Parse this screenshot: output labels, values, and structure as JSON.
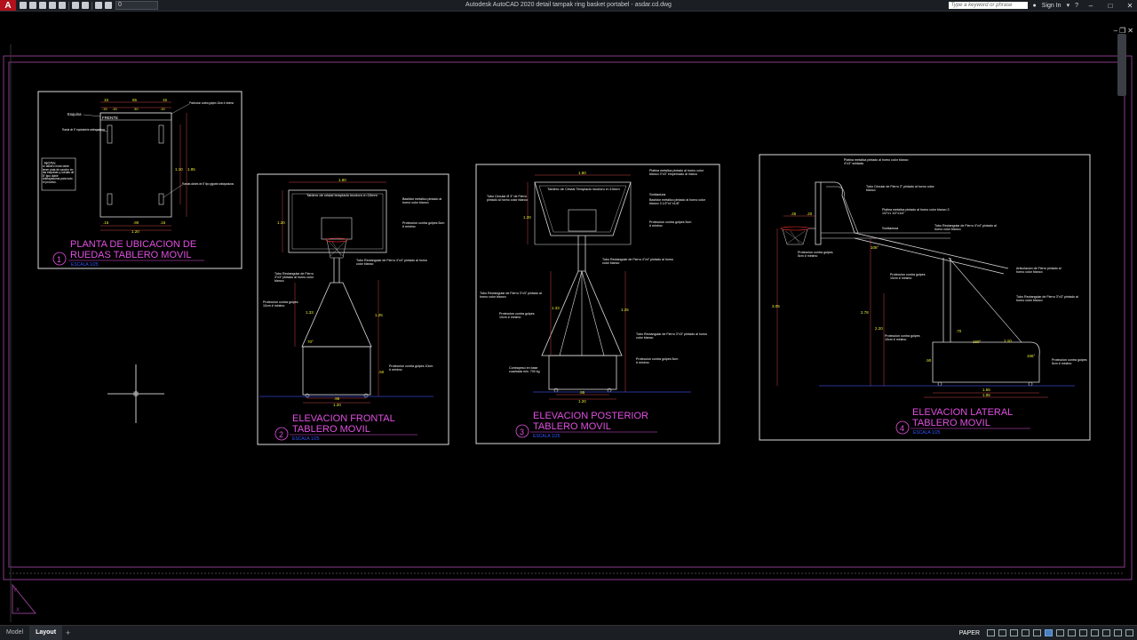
{
  "window": {
    "title": "Autodesk AutoCAD 2020   detail tampak ring basket portabel - asdar.cd.dwg",
    "app_button": "A",
    "workspace": "0",
    "search_placeholder": "Type a keyword or phrase",
    "sign_in": "Sign In"
  },
  "titlebar_icons": [
    "new-icon",
    "open-icon",
    "save-icon",
    "saveas-icon",
    "plot-icon",
    "undo-icon",
    "redo-icon",
    "sun-icon",
    "layer-icon"
  ],
  "drawing": {
    "plan": {
      "title_line1": "PLANTA DE UBICACION DE",
      "title_line2": "RUEDAS TABLERO MOVIL",
      "number": "1",
      "scale": "ESCALA  1/25",
      "dims_top": [
        "15",
        "65",
        "15"
      ],
      "dims_top2": [
        ".15",
        ".15",
        ".30",
        ".15"
      ],
      "dims_bottom": [
        ".15",
        ".90",
        ".15"
      ],
      "dim_bottom_total": "1.20",
      "dim_right": "1.85",
      "dim_right2": "1.10",
      "label_frente": "FRENTE",
      "label_esquina": "Esquina",
      "label_rueda": "Rueda de 5\" equivalente antirayaduras",
      "label_proteccion": "Proteccion contra golpes 10cm # minimo",
      "label_ruedas_largas": "Ruedas dobles de 8\" tipo gigante antirayaduras",
      "nota_title": "NOTA:",
      "nota_text": "El tablero movil debe tener pata de caucho en las esquinas y ruedas de 8\" tipo doble antirayaduras para todo el proceso."
    },
    "frontal": {
      "title_line1": "ELEVACION FRONTAL",
      "title_line2": "TABLERO MOVIL",
      "number": "2",
      "scale": "ESCALA  1/25",
      "dim_top": "1.80",
      "dim_left": "1.20",
      "dim_height": "1.25",
      "dim_mid": "1.33",
      "dim_bottom": "1.20",
      "dim_base": ".95",
      "dim_right_low": ".50",
      "label_tablero": "Tablero de cristal templado incoloro e=10mm",
      "label_bastidor": "Bastidor metalico pintado al horno color blanco",
      "label_proteccion": "Proteccion contra golpes 5cm # minimo",
      "label_tubo": "Tubo Rectangular de Fierro 4\"x4\" pintado al horno color blanco",
      "label_tubo2": "Tubo Rectangular de Fierro 3\"x3\" pintado al horno color blanco",
      "label_prot2": "Proteccion contra golpes 10cm # minimo",
      "label_prot3": "Proteccion contra golpes 10cm # minimo",
      "angle": "70°"
    },
    "posterior": {
      "title_line1": "ELEVACION POSTERIOR",
      "title_line2": "TABLERO MOVIL",
      "number": "3",
      "scale": "ESCALA  1/25",
      "dim_top": "1.80",
      "dim_left": "1.20",
      "dim_mid": "1.33",
      "dim_right": "1.25",
      "dim_bottom": "1.20",
      "dim_base": ".95",
      "label_tablero": "Tablero de Cristal Templado incoloro e=10mm",
      "label_platina": "Platina metalica pintado al horno color blanco 3\"x3\" empernado al marco",
      "label_soldadura": "Soldadura",
      "label_bastidor": "Bastidor metalico pintado al horno color blanco 3 1/2\"x1\"x1/8\"",
      "label_tubo_circ": "Tubo Circular Ø 3\" de Fierro pintado al horno color blanco",
      "label_proteccion": "Proteccion contra golpes 5cm # minimo",
      "label_tubo_rect": "Tubo Rectangular de Fierro 4\"x4\" pintado al horno color blanco",
      "label_tubo_rect2": "Tubo Rectangular de Fierro 3\"x3\" pintado al horno color blanco",
      "label_prot_low": "Proteccion contra golpes 10cm # minimo",
      "label_tubo3": "Tubo Rectangular de Fierro 3\"x3\" pintado al horno color blanco",
      "label_contrapeso": "Contrapeso en base cuadrada min. 700 kg",
      "label_prot_base": "Proteccion contra golpes 5cm # minimo"
    },
    "lateral": {
      "title_line1": "ELEVACION LATERAL",
      "title_line2": "TABLERO MOVIL",
      "number": "4",
      "scale": "ESCALA  1/25",
      "dim_total_h": "3.05",
      "dim_h2": "2.78",
      "dim_h3": "2.20",
      "dim_top_w": ".45",
      "dim_top_w2": ".20",
      "dim_bottom": "1.55",
      "dim_bottom2": "1.95",
      "dim_base_h": ".90",
      "dim_base_w": ".70",
      "dim_base_h2": "1.10",
      "angle1": "106°",
      "angle2": "160°",
      "angle3": "106°",
      "label_platina": "Platina metalica pintado al horno color blanco 4\"x3\" soldada",
      "label_tubo_circ": "Tubo Circular de Fierro 2\" pintado al horno color blanco",
      "label_platina2": "Platina metalica pintado al horno color blanco 3 1/2\"x1 1/2\"x1/4\"",
      "label_soldadura": "Soldadura",
      "label_tubo_rect": "Tubo Rectangular de Fierro 4\"x4\" pintado al horno color blanco",
      "label_prot": "Proteccion contra golpes 5cm # minimo",
      "label_articulacion": "Articulacion de Fierro pintado al horno color blanco",
      "label_prot2": "Proteccion contra golpes 10cm # minimo",
      "label_tubo_rect2": "Tubo Rectangular de Fierro 3\"x3\" pintado al horno color blanco",
      "label_prot3": "Proteccion contra golpes 10cm # minimo",
      "label_prot4": "Proteccion contra golpes 5cm # minimo"
    }
  },
  "statusbar": {
    "tabs": [
      "Model",
      "Layout"
    ],
    "active_tab": "Layout",
    "add_tab": "+",
    "paper": "PAPER"
  }
}
